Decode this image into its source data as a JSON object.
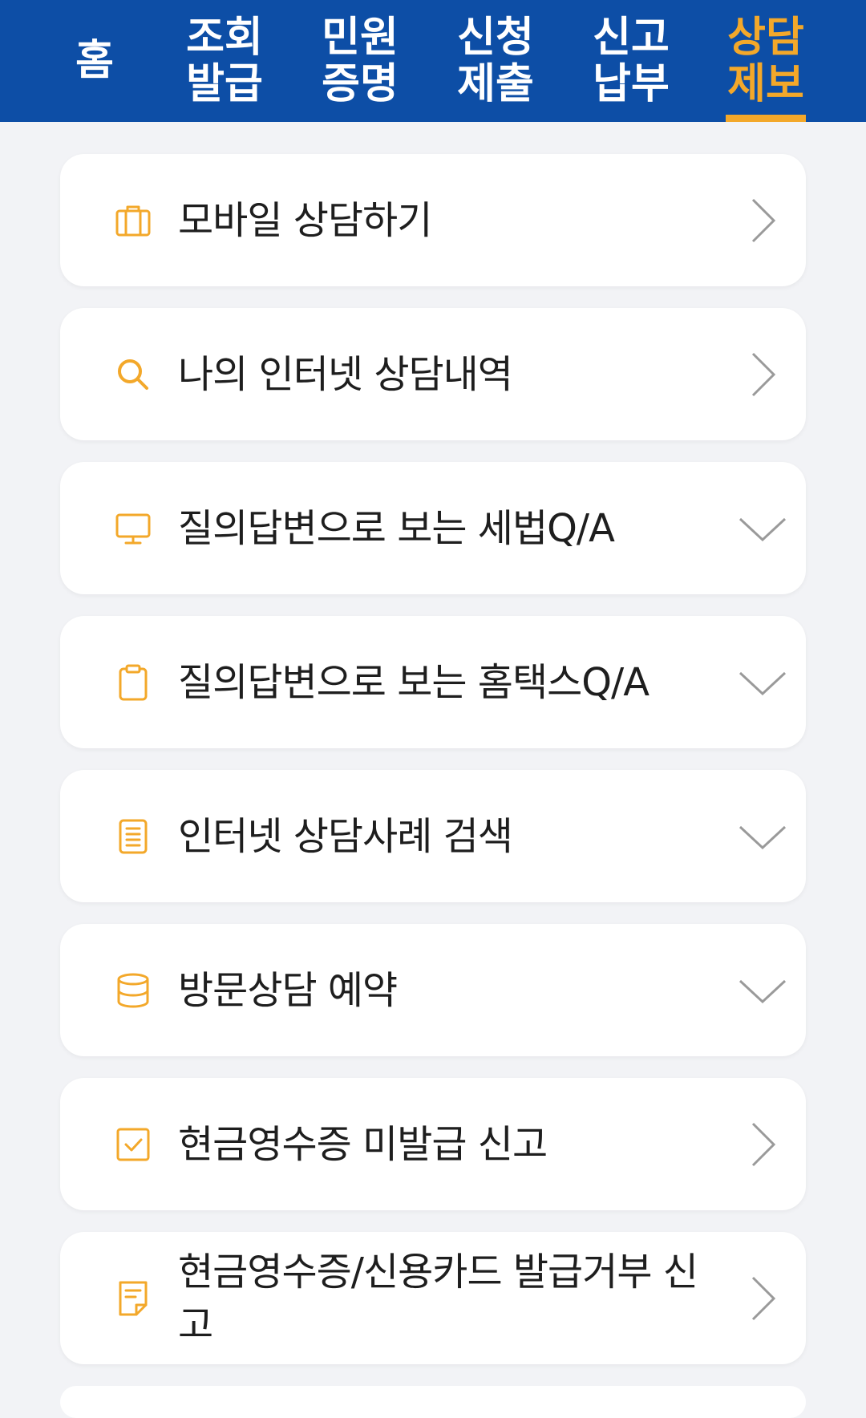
{
  "nav": {
    "home": "홈",
    "tabs": [
      {
        "line1": "조회",
        "line2": "발급"
      },
      {
        "line1": "민원",
        "line2": "증명"
      },
      {
        "line1": "신청",
        "line2": "제출"
      },
      {
        "line1": "신고",
        "line2": "납부"
      },
      {
        "line1": "상담",
        "line2": "제보"
      }
    ],
    "active_index": 4,
    "active_color": "#f3a82a",
    "bar_color": "#0d4ea6"
  },
  "menu": [
    {
      "label": "모바일 상담하기",
      "icon": "briefcase-icon",
      "indicator": "chevron-right"
    },
    {
      "label": "나의 인터넷 상담내역",
      "icon": "search-icon",
      "indicator": "chevron-right"
    },
    {
      "label": "질의답변으로 보는 세법Q/A",
      "icon": "monitor-icon",
      "indicator": "chevron-down"
    },
    {
      "label": "질의답변으로 보는 홈택스Q/A",
      "icon": "clipboard-icon",
      "indicator": "chevron-down"
    },
    {
      "label": "인터넷 상담사례 검색",
      "icon": "document-icon",
      "indicator": "chevron-down"
    },
    {
      "label": "방문상담 예약",
      "icon": "database-icon",
      "indicator": "chevron-down"
    },
    {
      "label": "현금영수증 미발급 신고",
      "icon": "checkbox-icon",
      "indicator": "chevron-right"
    },
    {
      "label": "현금영수증/신용카드 발급거부 신고",
      "icon": "note-icon",
      "indicator": "chevron-right"
    }
  ],
  "icon_color": "#f3a82a"
}
